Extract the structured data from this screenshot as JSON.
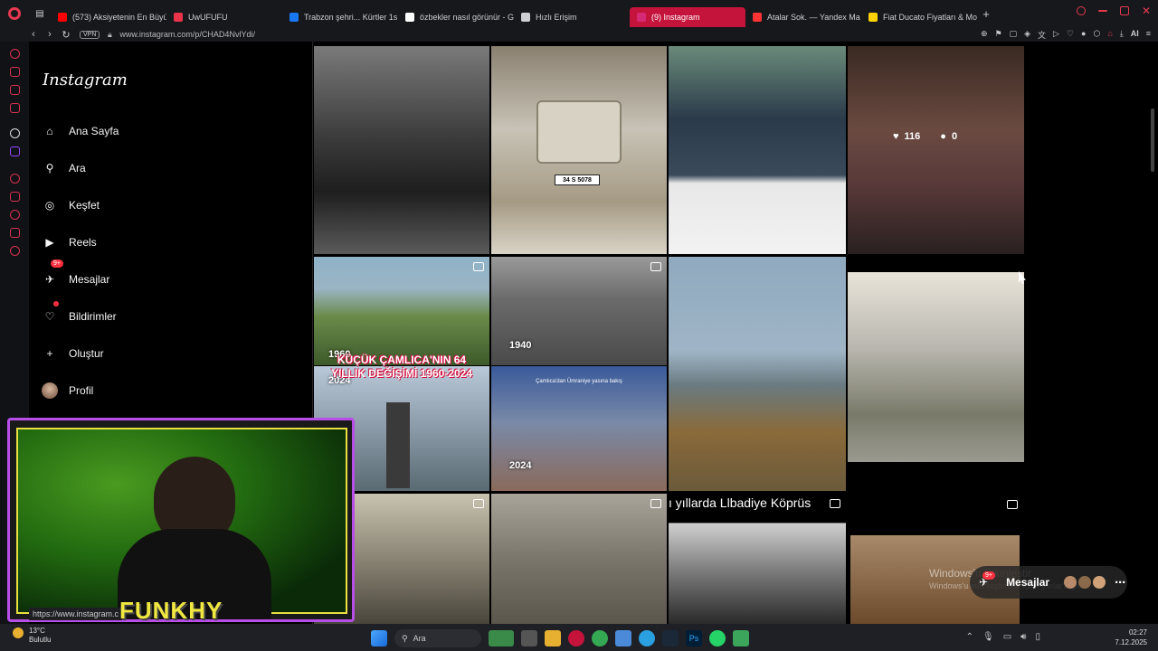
{
  "browser": {
    "tabs": [
      {
        "label": "(573) Aksiyetenin En Büyü",
        "fav_color": "#ff0000"
      },
      {
        "label": "UwUFUFU",
        "fav_color": "#e8334a"
      },
      {
        "label": "Trabzon şehri... Kürtler 1s",
        "fav_color": "#1877f2"
      },
      {
        "label": "özbekler nasıl görünür - G",
        "fav_color": "#ffffff"
      },
      {
        "label": "Hızlı Erişim",
        "fav_color": "#cfd0d4"
      },
      {
        "label": "(9) Instagram",
        "fav_color": "#d62976"
      },
      {
        "label": "Atalar Sok. — Yandex Ma",
        "fav_color": "#ff3333"
      },
      {
        "label": "Fiat Ducato Fiyatları & Mo",
        "fav_color": "#ffd200"
      }
    ],
    "active_tab_index": 5,
    "new_tab": "+",
    "url": "www.instagram.com/p/CHAD4NvlYdi/",
    "vpn_label": "VPN",
    "ai_label": "AI"
  },
  "instagram": {
    "logo": "Instagram",
    "nav": [
      {
        "name": "home",
        "label": "Ana Sayfa",
        "icon": "⌂"
      },
      {
        "name": "search",
        "label": "Ara",
        "icon": "⚲"
      },
      {
        "name": "explore",
        "label": "Keşfet",
        "icon": "◎"
      },
      {
        "name": "reels",
        "label": "Reels",
        "icon": "▶"
      },
      {
        "name": "messages",
        "label": "Mesajlar",
        "icon": "✈"
      },
      {
        "name": "notifications",
        "label": "Bildirimler",
        "icon": "♡"
      },
      {
        "name": "create",
        "label": "Oluştur",
        "icon": "+"
      },
      {
        "name": "profile",
        "label": "Profil",
        "icon": ""
      }
    ],
    "messages_badge": "9+"
  },
  "grid": {
    "post4_likes": "116",
    "post4_comments": "0",
    "year_1960": "1960",
    "year_1940": "1940",
    "year_2024_a": "2024",
    "year_2024_b": "2024",
    "camlica_title": "KÜÇÜK ÇAMLICA'NIN 64 YILLIK DEĞİŞİMİ 1960-2024",
    "camlica_small": "Çamlıca'dan Ümraniye yasına bakış",
    "plate": "34 S 5078",
    "libadiye_caption": "ı yıllarda Llbadiye Köprüs"
  },
  "overlay": {
    "funkhy": "FUNKHY",
    "status_url": "https://www.instagram.c",
    "windows_activate": "Windows'u Etkinleştir",
    "windows_activate_sub": "Windows'u etkinleştirmek için Ayarlar'a gidin.",
    "messages_pill": "Mesajlar",
    "messages_pill_badge": "9+"
  },
  "taskbar": {
    "temp": "13°C",
    "weather": "Bulutlu",
    "search": "Ara",
    "time": "02:27",
    "date": "7.12.2025"
  }
}
